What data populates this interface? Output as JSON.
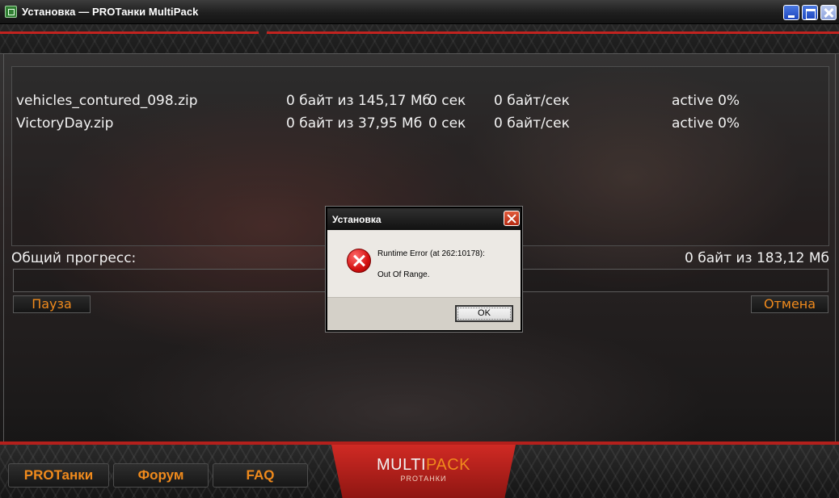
{
  "window": {
    "title": "Установка — PROТанки MultiPack"
  },
  "downloads": {
    "files": [
      {
        "name": "vehicles_contured_098.zip",
        "size": "0 байт из 145,17 Мб",
        "time": "0 сек",
        "speed": "0 байт/сек",
        "status": "active 0%"
      },
      {
        "name": "VictoryDay.zip",
        "size": "0 байт из 37,95 Мб",
        "time": "0 сек",
        "speed": "0 байт/сек",
        "status": "active 0%"
      }
    ],
    "total_label": "Общий прогресс:",
    "total_size": "0 байт из 183,12 Мб",
    "progress_fraction": 0,
    "pause_label": "Пауза",
    "cancel_label": "Отмена"
  },
  "bottom_nav": {
    "protanki_label": "PROТанки",
    "forum_label": "Форум",
    "faq_label": "FAQ",
    "logo_main_a": "MULTI",
    "logo_main_b": "PACK",
    "logo_sub": "PROТАНКИ"
  },
  "dialog": {
    "title": "Установка",
    "message_line1": "Runtime Error (at 262:10178):",
    "message_line2": "Out Of Range.",
    "ok_label": "OK",
    "icon": "error-icon"
  },
  "colors": {
    "accent_red": "#c2231f",
    "accent_orange": "#f08a1c"
  }
}
